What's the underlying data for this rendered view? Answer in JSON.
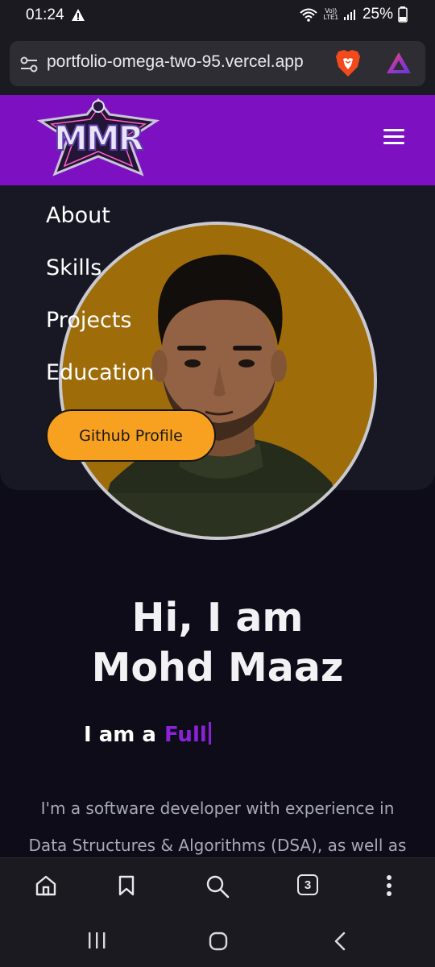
{
  "status_bar": {
    "time": "01:24",
    "battery": "25%",
    "volte_top": "Vo))",
    "volte_bottom": "LTE1"
  },
  "browser": {
    "url": "portfolio-omega-two-95.vercel.app",
    "tab_count": "3",
    "icons": [
      "site-settings-icon",
      "brave-shields-icon",
      "brave-rewards-icon",
      "home-icon",
      "bookmark-icon",
      "search-icon",
      "tabs-icon",
      "more-icon"
    ]
  },
  "site": {
    "logo_text": "MMR",
    "menu": [
      "About",
      "Skills",
      "Projects",
      "Education"
    ],
    "github_label": "Github Profile",
    "hero_line1": "Hi, I am",
    "hero_line2": "Mohd Maaz",
    "role_prefix": "I am a",
    "role_word": "Full",
    "bio_line1": "I'm a software developer with experience in",
    "bio_line2": "Data Structures & Algorithms (DSA), as well as"
  },
  "colors": {
    "header_purple": "#7d11c2",
    "accent_purple": "#8a22d8",
    "button_orange": "#f8a020",
    "avatar_bg": "#b67c0c",
    "page_bg": "#0d0c18"
  }
}
